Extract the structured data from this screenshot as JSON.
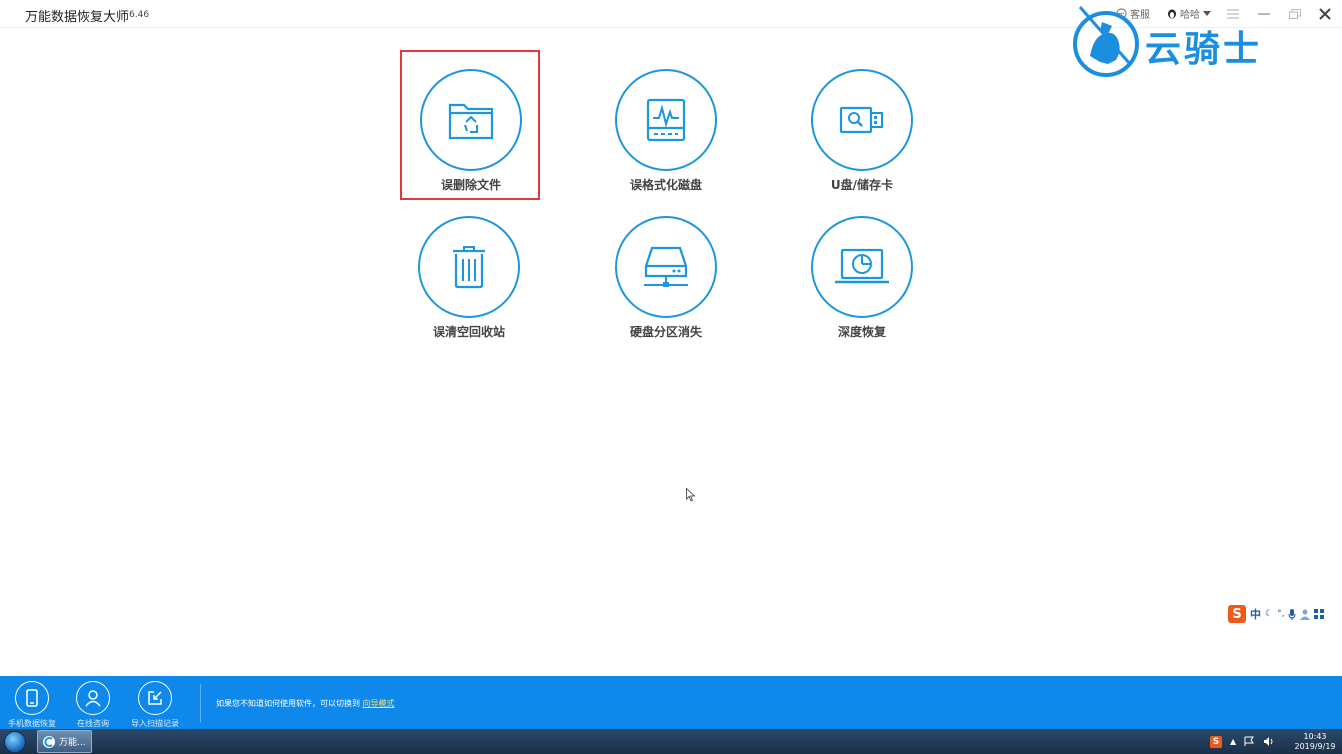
{
  "window": {
    "title": "万能数据恢复大师",
    "version": "6.46",
    "service_label": "客服",
    "user_label": "哈哈"
  },
  "watermark": {
    "text": "云骑士"
  },
  "tiles": [
    {
      "label": "误删除文件",
      "icon": "folder-recover-icon",
      "selected": true
    },
    {
      "label": "误格式化磁盘",
      "icon": "disk-format-icon"
    },
    {
      "label": "U盘/储存卡",
      "icon": "usb-drive-icon"
    },
    {
      "label": "误清空回收站",
      "icon": "trash-icon"
    },
    {
      "label": "硬盘分区消失",
      "icon": "hard-drive-icon"
    },
    {
      "label": "深度恢复",
      "icon": "laptop-scan-icon"
    }
  ],
  "bottom_bar": {
    "items": [
      {
        "label": "手机数据恢复",
        "icon": "phone-icon"
      },
      {
        "label": "在线咨询",
        "icon": "user-icon"
      },
      {
        "label": "导入扫描记录",
        "icon": "import-icon"
      }
    ],
    "hint": "如果您不知道如何使用软件，可以切换到",
    "hint_link": "向导模式"
  },
  "ime": {
    "logo": "S",
    "lang": "中"
  },
  "taskbar": {
    "app_label": "万能...",
    "time": "10:43",
    "date": "2019/9/19"
  },
  "colors": {
    "accent": "#1c96dc",
    "bottom_bar": "#0e88ea",
    "selection": "#e03a3a",
    "link": "#ffe35a"
  }
}
